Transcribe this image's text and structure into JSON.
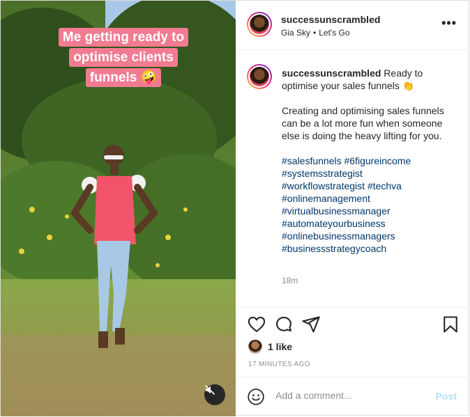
{
  "media": {
    "sticker_lines": [
      "Me getting ready to",
      "optimise clients",
      "funnels 🤪"
    ],
    "mute_icon": "speaker-muted-icon"
  },
  "header": {
    "username": "successunscrambled",
    "subtitle_user": "Gia Sky",
    "subtitle_separator": "•",
    "subtitle_audio": "Let's Go",
    "more_label": "•••"
  },
  "caption": {
    "username": "successunscrambled",
    "first_line": "Ready to optimise your sales funnels 👏",
    "body": "Creating and optimising sales funnels can be a lot more fun when someone else is doing the heavy lifting for you.",
    "hashtag_line1_a": "#salesfunnels",
    "hashtag_line1_b": "#6figureincome",
    "hashtag_line2": "#systemsstrategist",
    "hashtag_line3_a": "#workflowstrategist",
    "hashtag_line3_b": "#techva",
    "hashtag_line4": "#onlinemanagement",
    "hashtag_line5": "#virtualbusinessmanager",
    "hashtag_line6": "#automateyourbusiness",
    "hashtag_line7": "#onlinebusinessmanagers",
    "hashtag_line8": "#businessstrategycoach",
    "time": "18m"
  },
  "actions": {
    "like_icon": "heart-icon",
    "comment_icon": "comment-icon",
    "share_icon": "share-icon",
    "save_icon": "bookmark-icon",
    "likes": "1 like",
    "time_ago": "17 MINUTES AGO"
  },
  "add_comment": {
    "placeholder": "Add a comment...",
    "post_label": "Post"
  },
  "colors": {
    "hashtag": "#00376b",
    "sticker": "#f27b92",
    "post_disabled": "#b2dffc"
  }
}
